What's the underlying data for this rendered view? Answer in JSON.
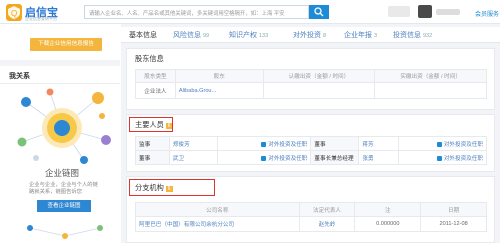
{
  "header": {
    "logo_text": "启信宝",
    "logo_sub": "企业信息查询平台",
    "search_placeholder": "请输入企业名、人名、产品名或其他关键词，多关键词用空格隔开，如：上海 平安",
    "vip_label": "会员服务"
  },
  "sidebar": {
    "report_button": "下载企业信用信息报告",
    "my_relations": "我关系",
    "graph_title": "企业链图",
    "graph_desc_1": "企业与企业，企业与个人的链",
    "graph_desc_2": "路就关系，链图告诉您",
    "graph_button": "查看企业链图"
  },
  "tabs": [
    {
      "label": "基本信息",
      "count": ""
    },
    {
      "label": "风险信息",
      "count": "99"
    },
    {
      "label": "知识产权",
      "count": "133"
    },
    {
      "label": "对外投资",
      "count": "8"
    },
    {
      "label": "企业年报",
      "count": "3"
    },
    {
      "label": "投资信息",
      "count": "932"
    }
  ],
  "shareholder": {
    "title": "股东信息",
    "columns": [
      "股东类型",
      "股东",
      "认缴出资（金额 / 时间）",
      "实缴出资（金额 / 时间）"
    ],
    "rows": [
      {
        "type": "企业法人",
        "name": "Alibaba.Grou...",
        "subscribed": "",
        "paid": ""
      }
    ]
  },
  "key_personnel": {
    "title": "主要人员",
    "count": "6",
    "link_label": "对外投资及任职",
    "rows": [
      {
        "role1": "监事",
        "name1": "郑俊芳",
        "role2": "董事",
        "name2": "蒋芳"
      },
      {
        "role1": "董事",
        "name1": "武卫",
        "role2": "董事长兼总经理",
        "name2": "张勇"
      }
    ]
  },
  "branches": {
    "title": "分支机构",
    "count": "6",
    "columns": [
      "公司名称",
      "法定代表人",
      "注",
      "日期"
    ],
    "rows": [
      {
        "company": "阿里巴巴（中国）有限公司余杭分公司",
        "legal_rep": "赵先岭",
        "capital": "0.000000",
        "date": "2011-12-08"
      }
    ]
  },
  "colors": {
    "accent_blue": "#1e8bd6",
    "orange": "#f3b53b",
    "highlight_red": "#e0342f"
  }
}
